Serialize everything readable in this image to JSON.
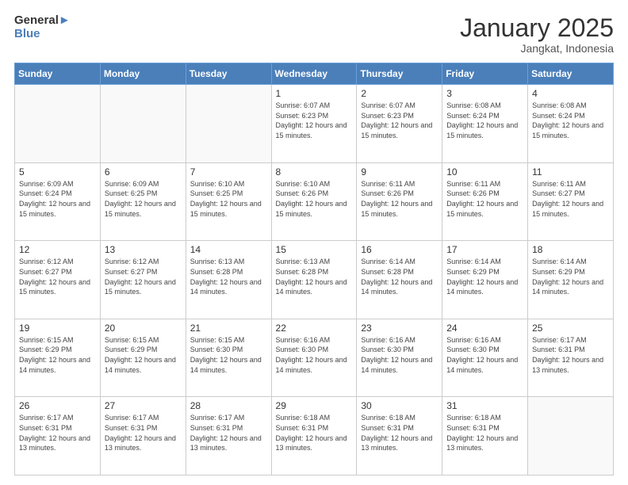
{
  "header": {
    "logo_general": "General",
    "logo_blue": "Blue",
    "title": "January 2025",
    "subtitle": "Jangkat, Indonesia"
  },
  "days_of_week": [
    "Sunday",
    "Monday",
    "Tuesday",
    "Wednesday",
    "Thursday",
    "Friday",
    "Saturday"
  ],
  "weeks": [
    [
      {
        "day": "",
        "info": ""
      },
      {
        "day": "",
        "info": ""
      },
      {
        "day": "",
        "info": ""
      },
      {
        "day": "1",
        "info": "Sunrise: 6:07 AM\nSunset: 6:23 PM\nDaylight: 12 hours\nand 15 minutes."
      },
      {
        "day": "2",
        "info": "Sunrise: 6:07 AM\nSunset: 6:23 PM\nDaylight: 12 hours\nand 15 minutes."
      },
      {
        "day": "3",
        "info": "Sunrise: 6:08 AM\nSunset: 6:24 PM\nDaylight: 12 hours\nand 15 minutes."
      },
      {
        "day": "4",
        "info": "Sunrise: 6:08 AM\nSunset: 6:24 PM\nDaylight: 12 hours\nand 15 minutes."
      }
    ],
    [
      {
        "day": "5",
        "info": "Sunrise: 6:09 AM\nSunset: 6:24 PM\nDaylight: 12 hours\nand 15 minutes."
      },
      {
        "day": "6",
        "info": "Sunrise: 6:09 AM\nSunset: 6:25 PM\nDaylight: 12 hours\nand 15 minutes."
      },
      {
        "day": "7",
        "info": "Sunrise: 6:10 AM\nSunset: 6:25 PM\nDaylight: 12 hours\nand 15 minutes."
      },
      {
        "day": "8",
        "info": "Sunrise: 6:10 AM\nSunset: 6:26 PM\nDaylight: 12 hours\nand 15 minutes."
      },
      {
        "day": "9",
        "info": "Sunrise: 6:11 AM\nSunset: 6:26 PM\nDaylight: 12 hours\nand 15 minutes."
      },
      {
        "day": "10",
        "info": "Sunrise: 6:11 AM\nSunset: 6:26 PM\nDaylight: 12 hours\nand 15 minutes."
      },
      {
        "day": "11",
        "info": "Sunrise: 6:11 AM\nSunset: 6:27 PM\nDaylight: 12 hours\nand 15 minutes."
      }
    ],
    [
      {
        "day": "12",
        "info": "Sunrise: 6:12 AM\nSunset: 6:27 PM\nDaylight: 12 hours\nand 15 minutes."
      },
      {
        "day": "13",
        "info": "Sunrise: 6:12 AM\nSunset: 6:27 PM\nDaylight: 12 hours\nand 15 minutes."
      },
      {
        "day": "14",
        "info": "Sunrise: 6:13 AM\nSunset: 6:28 PM\nDaylight: 12 hours\nand 14 minutes."
      },
      {
        "day": "15",
        "info": "Sunrise: 6:13 AM\nSunset: 6:28 PM\nDaylight: 12 hours\nand 14 minutes."
      },
      {
        "day": "16",
        "info": "Sunrise: 6:14 AM\nSunset: 6:28 PM\nDaylight: 12 hours\nand 14 minutes."
      },
      {
        "day": "17",
        "info": "Sunrise: 6:14 AM\nSunset: 6:29 PM\nDaylight: 12 hours\nand 14 minutes."
      },
      {
        "day": "18",
        "info": "Sunrise: 6:14 AM\nSunset: 6:29 PM\nDaylight: 12 hours\nand 14 minutes."
      }
    ],
    [
      {
        "day": "19",
        "info": "Sunrise: 6:15 AM\nSunset: 6:29 PM\nDaylight: 12 hours\nand 14 minutes."
      },
      {
        "day": "20",
        "info": "Sunrise: 6:15 AM\nSunset: 6:29 PM\nDaylight: 12 hours\nand 14 minutes."
      },
      {
        "day": "21",
        "info": "Sunrise: 6:15 AM\nSunset: 6:30 PM\nDaylight: 12 hours\nand 14 minutes."
      },
      {
        "day": "22",
        "info": "Sunrise: 6:16 AM\nSunset: 6:30 PM\nDaylight: 12 hours\nand 14 minutes."
      },
      {
        "day": "23",
        "info": "Sunrise: 6:16 AM\nSunset: 6:30 PM\nDaylight: 12 hours\nand 14 minutes."
      },
      {
        "day": "24",
        "info": "Sunrise: 6:16 AM\nSunset: 6:30 PM\nDaylight: 12 hours\nand 14 minutes."
      },
      {
        "day": "25",
        "info": "Sunrise: 6:17 AM\nSunset: 6:31 PM\nDaylight: 12 hours\nand 13 minutes."
      }
    ],
    [
      {
        "day": "26",
        "info": "Sunrise: 6:17 AM\nSunset: 6:31 PM\nDaylight: 12 hours\nand 13 minutes."
      },
      {
        "day": "27",
        "info": "Sunrise: 6:17 AM\nSunset: 6:31 PM\nDaylight: 12 hours\nand 13 minutes."
      },
      {
        "day": "28",
        "info": "Sunrise: 6:17 AM\nSunset: 6:31 PM\nDaylight: 12 hours\nand 13 minutes."
      },
      {
        "day": "29",
        "info": "Sunrise: 6:18 AM\nSunset: 6:31 PM\nDaylight: 12 hours\nand 13 minutes."
      },
      {
        "day": "30",
        "info": "Sunrise: 6:18 AM\nSunset: 6:31 PM\nDaylight: 12 hours\nand 13 minutes."
      },
      {
        "day": "31",
        "info": "Sunrise: 6:18 AM\nSunset: 6:31 PM\nDaylight: 12 hours\nand 13 minutes."
      },
      {
        "day": "",
        "info": ""
      }
    ]
  ]
}
